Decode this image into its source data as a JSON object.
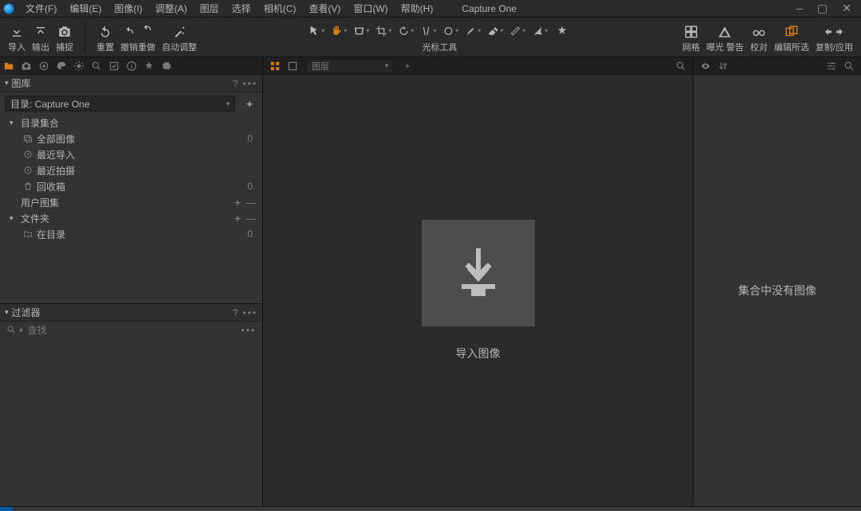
{
  "app_title": "Capture One",
  "menu": [
    "文件(F)",
    "编辑(E)",
    "图像(I)",
    "调整(A)",
    "图层",
    "选择",
    "相机(C)",
    "查看(V)",
    "窗口(W)",
    "帮助(H)"
  ],
  "toolbar_left": [
    {
      "id": "import",
      "label": "导入"
    },
    {
      "id": "export",
      "label": "输出"
    },
    {
      "id": "capture",
      "label": "捕捉"
    }
  ],
  "toolbar_edit": [
    {
      "id": "reset",
      "label": "重置"
    },
    {
      "id": "undoredo",
      "label": "撤销重做"
    },
    {
      "id": "autoadjust",
      "label": "自动调整"
    }
  ],
  "cursor_tools_label": "光标工具",
  "toolbar_right": [
    {
      "id": "grid",
      "label": "网格"
    },
    {
      "id": "exposure-warning",
      "label": "曝光 警告"
    },
    {
      "id": "proof",
      "label": "校对"
    },
    {
      "id": "edit-all",
      "label": "编辑所选"
    },
    {
      "id": "copy-apply",
      "label": "复制/应用"
    }
  ],
  "library": {
    "panel_title": "图库",
    "catalog_label": "目录: Capture One",
    "catalog_collection": {
      "label": "目录集合"
    },
    "items": [
      {
        "id": "all-images",
        "label": "全部图像",
        "count": "0"
      },
      {
        "id": "recent-imports",
        "label": "最近导入",
        "count": ""
      },
      {
        "id": "recent-captures",
        "label": "最近拍摄",
        "count": ""
      },
      {
        "id": "trash",
        "label": "回收箱",
        "count": "0"
      }
    ],
    "user_collections": "用户图集",
    "folders": {
      "label": "文件夹",
      "items": [
        {
          "id": "in-catalog",
          "label": "在目录",
          "count": "0"
        }
      ]
    }
  },
  "filter": {
    "panel_title": "过滤器",
    "search_placeholder": "查找"
  },
  "viewer": {
    "variant_label": "图层",
    "drop_label": "导入图像"
  },
  "browser": {
    "empty_message": "集合中没有图像"
  }
}
